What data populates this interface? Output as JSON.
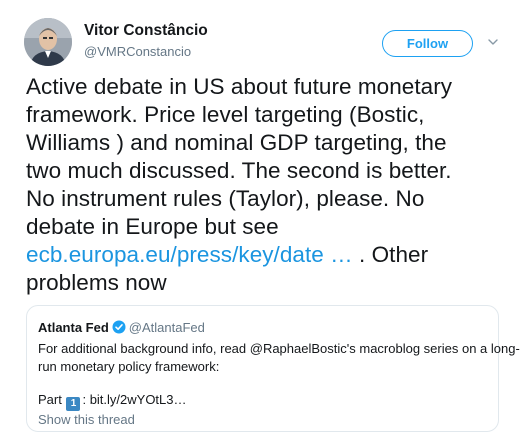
{
  "author": {
    "name": "Vitor Constâncio",
    "handle": "@VMRConstancio"
  },
  "follow_label": "Follow",
  "tweet": {
    "lines": [
      "Active debate in US about future monetary",
      "framework. Price level targeting (Bostic,",
      "Williams ) and nominal GDP targeting, the",
      "two much discussed. The second is better.",
      "No instrument rules (Taylor), please.  No",
      "debate in Europe but see"
    ],
    "link": "ecb.europa.eu/press/key/date …",
    "after_link": " . Other",
    "last_line": "problems now"
  },
  "quoted": {
    "name": "Atlanta Fed",
    "handle": "@AtlantaFed",
    "lines": [
      "For additional background info, read @RaphaelBostic's macroblog series on a long-",
      "run monetary policy framework:"
    ],
    "part_label": "Part",
    "part_emoji": "1",
    "part_rest": ": bit.ly/2wYOtL3…",
    "show_thread": "Show this thread"
  },
  "colors": {
    "link": "#1b95e0",
    "follow": "#1da1f2",
    "secondary": "#657786",
    "border": "#e1e8ed"
  },
  "icons": [
    "avatar",
    "chevron-down-icon",
    "verified-badge-icon",
    "keycap-1-emoji"
  ]
}
